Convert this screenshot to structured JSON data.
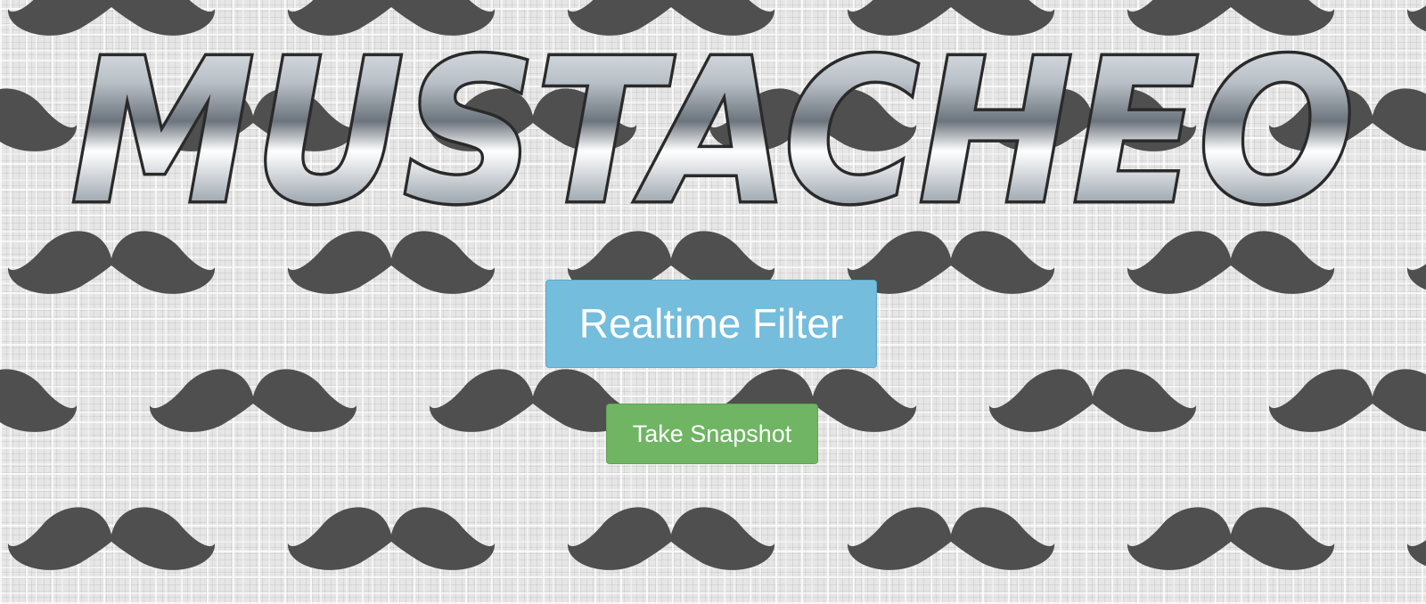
{
  "app": {
    "logo_text": "MUSTACHEO"
  },
  "background": {
    "pattern_icon": "mustache-icon",
    "mustache_color": "#4f4f4f"
  },
  "buttons": {
    "realtime_filter_label": "Realtime Filter",
    "take_snapshot_label": "Take Snapshot"
  },
  "colors": {
    "realtime_filter_bg": "#74bddd",
    "take_snapshot_bg": "#6fb563"
  }
}
